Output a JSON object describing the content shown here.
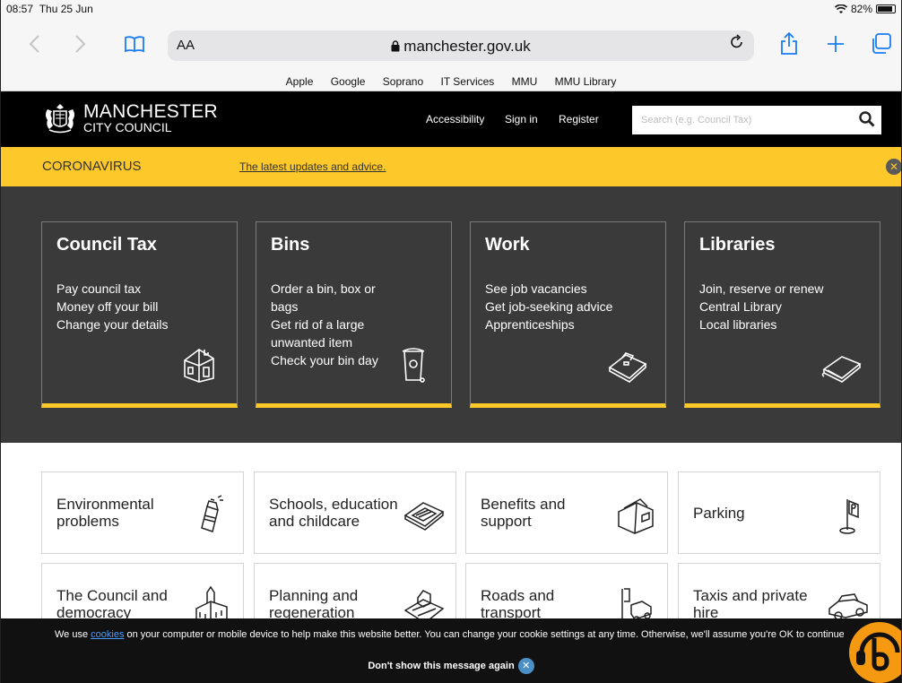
{
  "status": {
    "time": "08:57",
    "date": "Thu 25 Jun",
    "battery": "82%"
  },
  "browser": {
    "aa_label": "AA",
    "url": "manchester.gov.uk"
  },
  "favourites": [
    "Apple",
    "Google",
    "Soprano",
    "IT Services",
    "MMU",
    "MMU Library"
  ],
  "header": {
    "logo_line1": "MANCHESTER",
    "logo_line2": "CITY COUNCIL",
    "links": [
      "Accessibility",
      "Sign in",
      "Register"
    ],
    "search_placeholder": "Search (e.g. Council Tax)"
  },
  "banner": {
    "title": "CORONAVIRUS",
    "link": "The latest updates and advice",
    "link_suffix": "."
  },
  "tiles": [
    {
      "title": "Council Tax",
      "items": [
        "Pay council tax",
        "Money off your bill",
        "Change your details"
      ],
      "icon": "house-icon"
    },
    {
      "title": "Bins",
      "items": [
        "Order a bin, box or bags",
        "Get rid of a large unwanted item",
        "Check your bin day"
      ],
      "icon": "bin-icon"
    },
    {
      "title": "Work",
      "items": [
        "See job vacancies",
        "Get job-seeking advice",
        "Apprenticeships"
      ],
      "icon": "briefcase-icon"
    },
    {
      "title": "Libraries",
      "items": [
        "Join, reserve or renew",
        "Central Library",
        "Local libraries"
      ],
      "icon": "book-icon"
    }
  ],
  "grid": [
    {
      "label": "Environmental problems",
      "icon": "spray-can-icon"
    },
    {
      "label": "Schools, education and childcare",
      "icon": "school-icon"
    },
    {
      "label": "Benefits and support",
      "icon": "wallet-icon"
    },
    {
      "label": "Parking",
      "icon": "parking-sign-icon"
    },
    {
      "label": "The Council and democracy",
      "icon": "town-hall-icon"
    },
    {
      "label": "Planning and regeneration",
      "icon": "map-house-icon"
    },
    {
      "label": "Roads and transport",
      "icon": "road-car-icon"
    },
    {
      "label": "Taxis and private hire",
      "icon": "taxi-icon"
    }
  ],
  "cookie": {
    "before": "We use ",
    "link": "cookies",
    "after": " on your computer or mobile device to help make this website better. You can change your cookie settings at any time. Otherwise, we'll assume you're OK to continue.",
    "dismiss": "Don't show this message again"
  }
}
